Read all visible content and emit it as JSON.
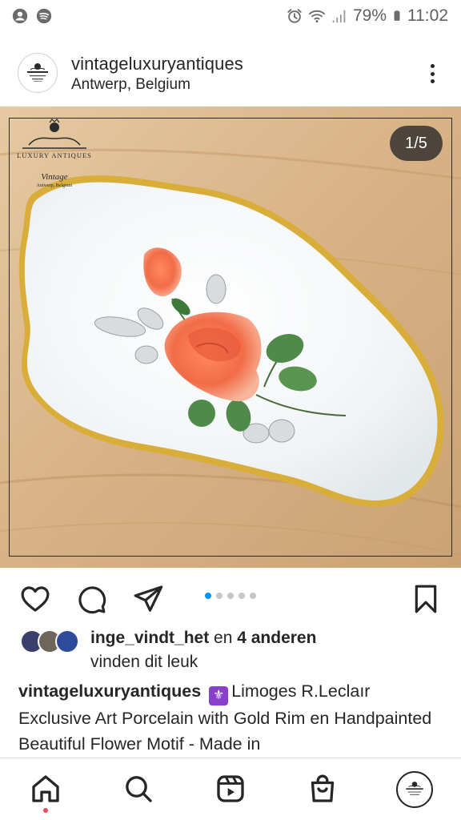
{
  "status_bar": {
    "battery": "79%",
    "time": "11:02",
    "icons": [
      "account-circle-icon",
      "spotify-icon",
      "alarm-icon",
      "wifi-icon",
      "signal-icon",
      "battery-icon"
    ]
  },
  "post": {
    "account": "vintageluxuryantiques",
    "location": "Antwerp, Belgium",
    "image_counter": "1/5",
    "carousel": {
      "total": 5,
      "active_index": 0
    },
    "watermark": {
      "line1": "Luxury Antiques",
      "line2": "Vintage",
      "line3": "Antwerp, Belgium"
    },
    "likes": {
      "user": "inge_vindt_het",
      "connector": " en ",
      "others": "4 anderen",
      "suffix": "vinden dit leuk"
    },
    "caption": {
      "account": "vintageluxuryantiques",
      "emoji": "⚜️",
      "text": "Limoges R.Leclaır Exclusive Art Porcelain with Gold Rim en Handpainted Beautiful Flower Motif -  Made in"
    }
  },
  "colors": {
    "text": "#262626",
    "accent_blue": "#0095f6",
    "notification_red": "#ed4956",
    "emoji_purple": "#8a3fc8"
  }
}
